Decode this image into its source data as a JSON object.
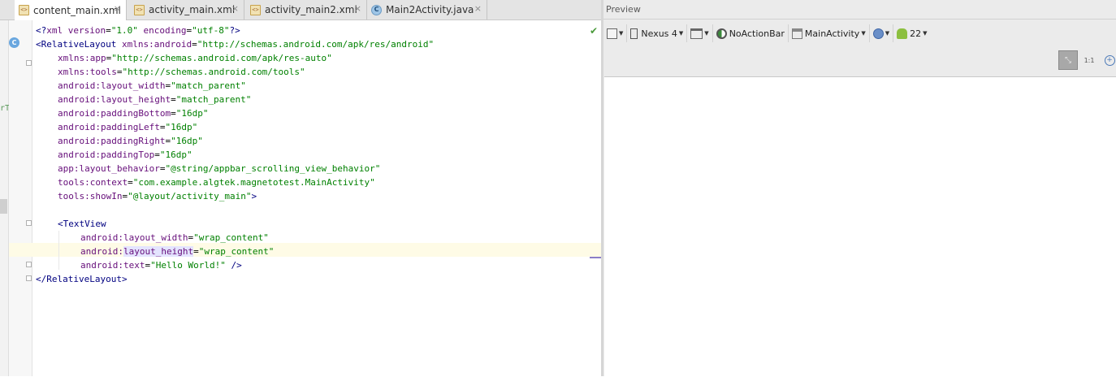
{
  "tabs": [
    {
      "label": "content_main.xml",
      "icon": "xml-file-icon",
      "active": true
    },
    {
      "label": "activity_main.xml",
      "icon": "xml-file-icon",
      "active": false
    },
    {
      "label": "activity_main2.xml",
      "icon": "xml-file-icon",
      "active": false
    },
    {
      "label": "Main2Activity.java",
      "icon": "java-class-icon",
      "active": false
    }
  ],
  "tab_close_glyph": "×",
  "left_strip_text": "rT",
  "gutter_icon": "C",
  "code": {
    "line1": {
      "a": "<?",
      "b": "xml version",
      "c": "=",
      "d": "\"1.0\"",
      "e": " encoding",
      "f": "=",
      "g": "\"utf-8\"",
      "h": "?>"
    },
    "line2": {
      "a": "<RelativeLayout ",
      "b": "xmlns:",
      "c": "android",
      "d": "=",
      "e": "\"http://schemas.android.com/apk/res/android\""
    },
    "line3": {
      "a": "xmlns:",
      "b": "app",
      "c": "=",
      "d": "\"http://schemas.android.com/apk/res-auto\""
    },
    "line4": {
      "a": "xmlns:",
      "b": "tools",
      "c": "=",
      "d": "\"http://schemas.android.com/tools\""
    },
    "line5": {
      "a": "android:",
      "b": "layout_width",
      "c": "=",
      "d": "\"match_parent\""
    },
    "line6": {
      "a": "android:",
      "b": "layout_height",
      "c": "=",
      "d": "\"match_parent\""
    },
    "line7": {
      "a": "android:",
      "b": "paddingBottom",
      "c": "=",
      "d": "\"16dp\""
    },
    "line8": {
      "a": "android:",
      "b": "paddingLeft",
      "c": "=",
      "d": "\"16dp\""
    },
    "line9": {
      "a": "android:",
      "b": "paddingRight",
      "c": "=",
      "d": "\"16dp\""
    },
    "line10": {
      "a": "android:",
      "b": "paddingTop",
      "c": "=",
      "d": "\"16dp\""
    },
    "line11": {
      "a": "app:",
      "b": "layout_behavior",
      "c": "=",
      "d": "\"@string/appbar_scrolling_view_behavior\""
    },
    "line12": {
      "a": "tools:",
      "b": "context",
      "c": "=",
      "d": "\"com.example.algtek.magnetotest.MainActivity\""
    },
    "line13": {
      "a": "tools:",
      "b": "showIn",
      "c": "=",
      "d": "\"@layout/activity_main\"",
      "e": ">"
    },
    "line15": {
      "a": "<TextView"
    },
    "line16": {
      "a": "android:",
      "b": "layout_width",
      "c": "=",
      "d": "\"wrap_content\""
    },
    "line17": {
      "a": "android:",
      "b": "layout_height",
      "c": "=",
      "d": "\"wrap_content\""
    },
    "line18": {
      "a": "android:",
      "b": "text",
      "c": "=",
      "d": "\"Hello World!\"",
      "e": " />"
    },
    "line19": {
      "a": "</RelativeLayout>"
    }
  },
  "preview": {
    "title": "Preview",
    "device": "Nexus 4",
    "theme": "NoActionBar",
    "activity": "MainActivity",
    "api": "22",
    "zoom_actual_label": "1:1"
  },
  "colors": {
    "tag": "#000080",
    "attribute": "#660e7a",
    "value": "#008000",
    "current_line": "#fefbe6"
  }
}
